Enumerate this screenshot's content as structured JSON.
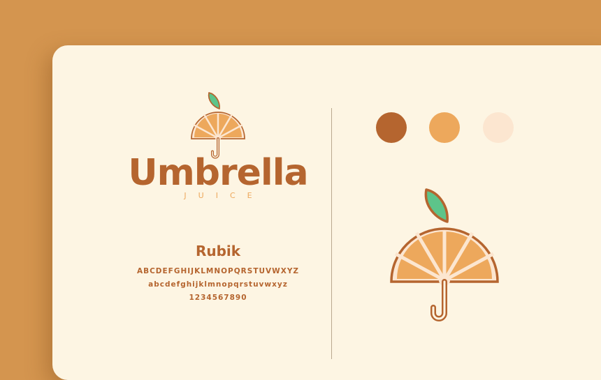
{
  "brand": {
    "name": "Umbrella",
    "tagline": "JUICE"
  },
  "typography": {
    "font_name": "Rubik",
    "uppercase": "ABCDEFGHIJKLMNOPQRSTUVWXYZ",
    "lowercase": "abcdefghijklmnopqrstuvwxyz",
    "digits": "1234567890"
  },
  "palette": [
    "#B5652F",
    "#EDA85C",
    "#FCE6D0"
  ],
  "colors": {
    "background": "#D4954F",
    "card": "#FDF5E3",
    "leaf": "#5DC48A"
  },
  "icons": [
    "umbrella-orange-logo-icon"
  ]
}
